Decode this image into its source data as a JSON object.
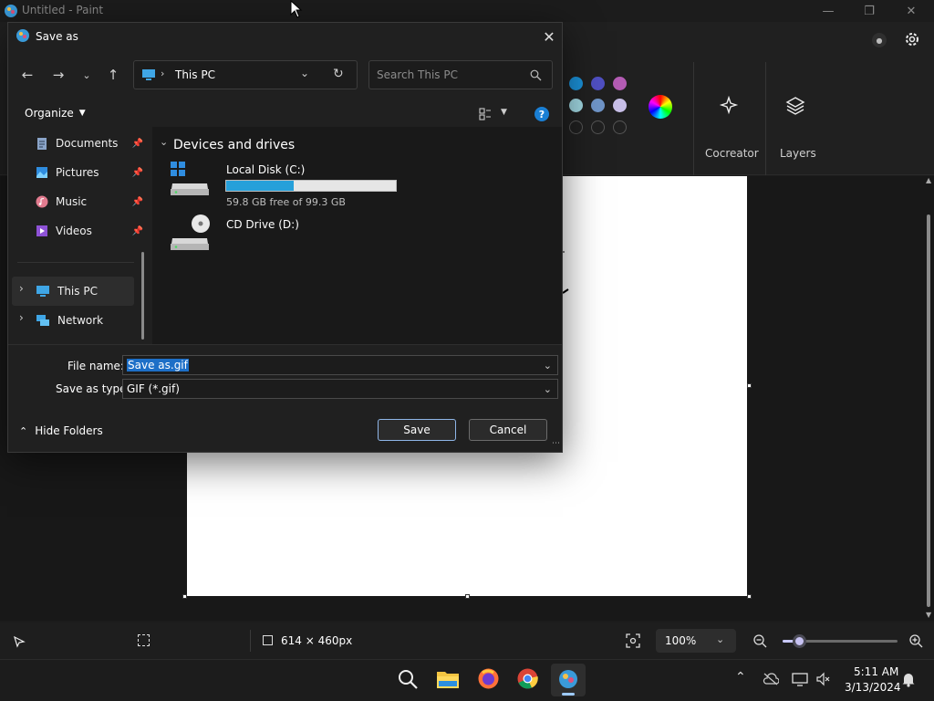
{
  "paint": {
    "title": "Untitled - Paint",
    "ribbon": {
      "cocreator_label": "Cocreator",
      "layers_label": "Layers",
      "colors": [
        "#1a8fd6",
        "#4f4fc2",
        "#b45cb4",
        "#9fd6e0",
        "#6f95c8",
        "#c8bfe8"
      ]
    },
    "status": {
      "canvas_size": "614 × 460px",
      "zoom": "100%"
    }
  },
  "dialog": {
    "title": "Save as",
    "address": {
      "location": "This PC"
    },
    "search": {
      "placeholder": "Search This PC"
    },
    "toolbar": {
      "organize_label": "Organize"
    },
    "nav": {
      "items": [
        {
          "label": "Documents",
          "icon": "documents-icon",
          "pinned": true
        },
        {
          "label": "Pictures",
          "icon": "pictures-icon",
          "pinned": true
        },
        {
          "label": "Music",
          "icon": "music-icon",
          "pinned": true
        },
        {
          "label": "Videos",
          "icon": "videos-icon",
          "pinned": true
        },
        {
          "label": "This PC",
          "icon": "this-pc-icon",
          "pinned": false
        },
        {
          "label": "Network",
          "icon": "network-icon",
          "pinned": false
        }
      ]
    },
    "content": {
      "group_label": "Devices and drives",
      "drives": [
        {
          "name": "Local Disk (C:)",
          "free_text": "59.8 GB free of 99.3 GB",
          "used_fraction": 0.4
        },
        {
          "name": "CD Drive (D:)"
        }
      ]
    },
    "form": {
      "file_name_label": "File name:",
      "file_name_value": "Save as.gif",
      "type_label": "Save as type:",
      "type_value": "GIF (*.gif)"
    },
    "hide_folders_label": "Hide Folders",
    "save_label": "Save",
    "cancel_label": "Cancel"
  },
  "taskbar": {
    "time": "5:11 AM",
    "date": "3/13/2024"
  }
}
